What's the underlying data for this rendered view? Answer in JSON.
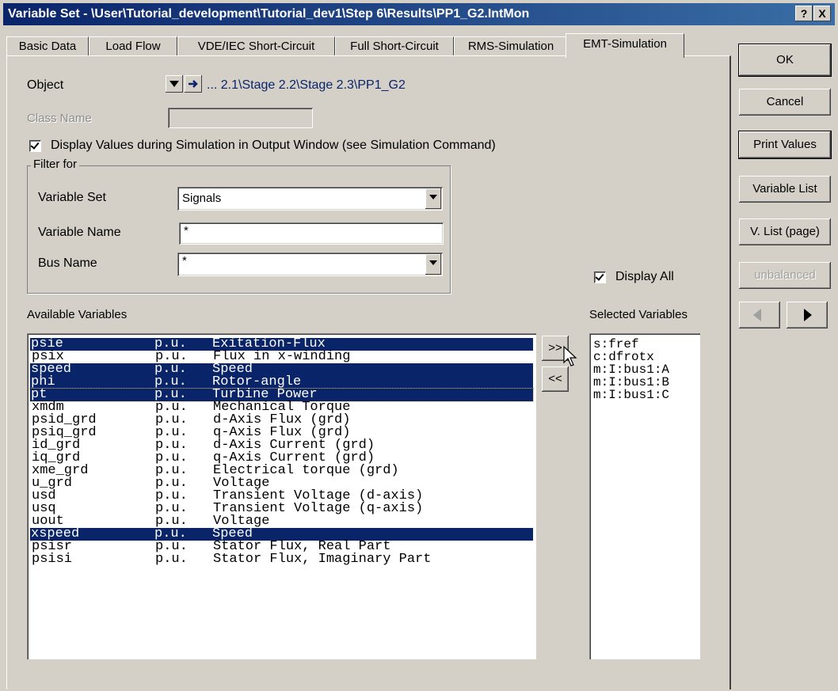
{
  "window": {
    "title": "Variable Set - \\User\\Tutorial_development\\Tutorial_dev1\\Step 6\\Results\\PP1_G2.IntMon",
    "help_button": "?",
    "close_button": "X"
  },
  "tabs": [
    "Basic Data",
    "Load Flow",
    "VDE/IEC Short-Circuit",
    "Full Short-Circuit",
    "RMS-Simulation",
    "EMT-Simulation"
  ],
  "active_tab": "EMT-Simulation",
  "object": {
    "label": "Object",
    "path": "... 2.1\\Stage 2.2\\Stage 2.3\\PP1_G2"
  },
  "class_name": {
    "label": "Class Name",
    "value": ""
  },
  "display_values": {
    "label": "Display Values during Simulation in Output Window (see Simulation Command)",
    "checked": true
  },
  "filter": {
    "title": "Filter for",
    "variable_set_label": "Variable Set",
    "variable_set_value": "Signals",
    "variable_name_label": "Variable Name",
    "variable_name_value": "*",
    "bus_name_label": "Bus Name",
    "bus_name_value": "*"
  },
  "display_all": {
    "label": "Display All",
    "checked": true
  },
  "available": {
    "label": "Available Variables",
    "rows": [
      {
        "name": "psie",
        "unit": "p.u.",
        "desc": "Exitation-Flux",
        "selected": true
      },
      {
        "name": "psix",
        "unit": "p.u.",
        "desc": "Flux in x-winding",
        "selected": false
      },
      {
        "name": "speed",
        "unit": "p.u.",
        "desc": "Speed",
        "selected": true
      },
      {
        "name": "phi",
        "unit": "p.u.",
        "desc": "Rotor-angle",
        "selected": true
      },
      {
        "name": "pt",
        "unit": "p.u.",
        "desc": "Turbine Power",
        "selected": true
      },
      {
        "name": "xmdm",
        "unit": "p.u.",
        "desc": "Mechanical Torque",
        "selected": false
      },
      {
        "name": "psid_grd",
        "unit": "p.u.",
        "desc": "d-Axis Flux (grd)",
        "selected": false
      },
      {
        "name": "psiq_grd",
        "unit": "p.u.",
        "desc": "q-Axis Flux (grd)",
        "selected": false
      },
      {
        "name": "id_grd",
        "unit": "p.u.",
        "desc": "d-Axis Current (grd)",
        "selected": false
      },
      {
        "name": "iq_grd",
        "unit": "p.u.",
        "desc": "q-Axis Current (grd)",
        "selected": false
      },
      {
        "name": "xme_grd",
        "unit": "p.u.",
        "desc": "Electrical torque (grd)",
        "selected": false
      },
      {
        "name": "u_grd",
        "unit": "p.u.",
        "desc": "Voltage",
        "selected": false
      },
      {
        "name": "usd",
        "unit": "p.u.",
        "desc": "Transient Voltage (d-axis)",
        "selected": false
      },
      {
        "name": "usq",
        "unit": "p.u.",
        "desc": "Transient Voltage (q-axis)",
        "selected": false
      },
      {
        "name": "uout",
        "unit": "p.u.",
        "desc": "Voltage",
        "selected": false
      },
      {
        "name": "xspeed",
        "unit": "p.u.",
        "desc": "Speed",
        "selected": true
      },
      {
        "name": "psisr",
        "unit": "p.u.",
        "desc": "Stator Flux, Real Part",
        "selected": false
      },
      {
        "name": "psisi",
        "unit": "p.u.",
        "desc": "Stator Flux, Imaginary Part",
        "selected": false
      }
    ]
  },
  "selected": {
    "label": "Selected Variables",
    "rows": [
      "s:fref",
      "c:dfrotx",
      "m:I:bus1:A",
      "m:I:bus1:B",
      "m:I:bus1:C"
    ]
  },
  "move_buttons": {
    "add": ">>",
    "remove": "<<"
  },
  "side_buttons": {
    "ok": "OK",
    "cancel": "Cancel",
    "print_values": "Print Values",
    "variable_list": "Variable List",
    "v_list_page": "V. List (page)",
    "unbalanced": "unbalanced"
  },
  "colors": {
    "title_start": "#0a246a",
    "title_end": "#3a6ea5",
    "selection": "#0a246a",
    "dialog": "#d4d0c8"
  }
}
